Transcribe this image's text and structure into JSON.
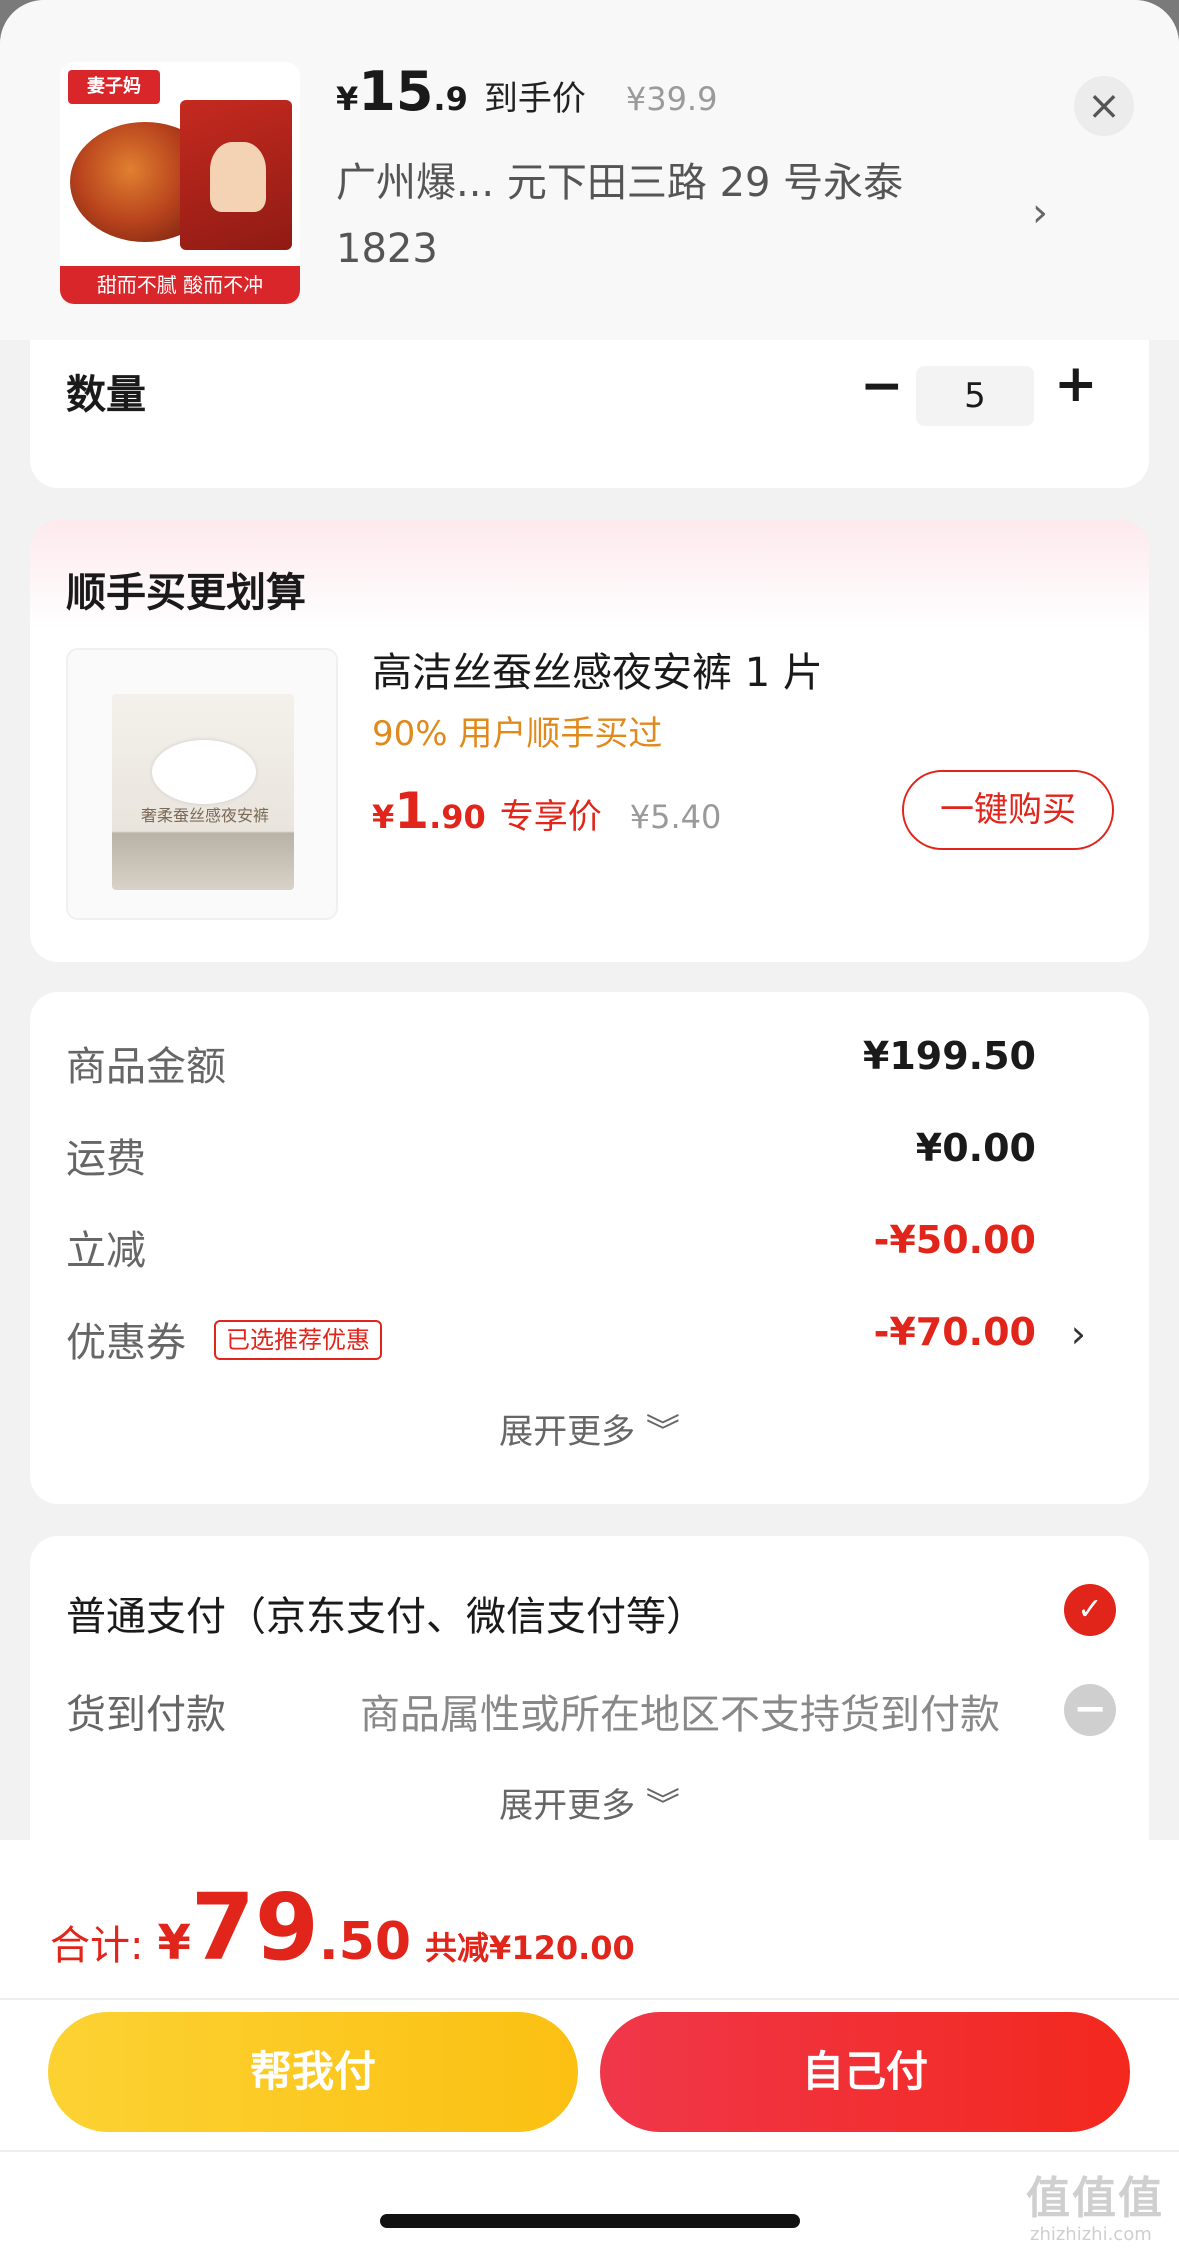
{
  "product": {
    "thumb_brand": "妻子妈 Maizi Mom",
    "thumb_slogan": "甜而不腻 酸而不冲",
    "price_currency": "¥",
    "price_int": "15",
    "price_dec": ".9",
    "price_tag": "到手价",
    "original_price": "¥39.9",
    "address": "广州爆...  元下田三路 29 号永泰 1823"
  },
  "quantity": {
    "label": "数量",
    "minus": "−",
    "value": "5",
    "plus": "+"
  },
  "upsell": {
    "title": "顺手买更划算",
    "item_image_text": "奢柔蚕丝感夜安裤",
    "item_name": "高洁丝蚕丝感夜安裤 1 片",
    "popularity": "90% 用户顺手买过",
    "price_currency": "¥",
    "price_int": "1",
    "price_dec": ".90",
    "price_tag": "专享价",
    "original_price": "¥5.40",
    "buy_button": "一键购买"
  },
  "summary": {
    "rows": [
      {
        "label": "商品金额",
        "value": "¥199.50"
      },
      {
        "label": "运费",
        "value": "¥0.00"
      },
      {
        "label": "立减",
        "value": "-¥50.00"
      },
      {
        "label": "优惠券",
        "value": "-¥70.00",
        "badge": "已选推荐优惠"
      }
    ],
    "expand_label": "展开更多 ︾"
  },
  "payment": {
    "option_normal": "普通支付（京东支付、微信支付等）",
    "option_cod": "货到付款",
    "cod_note": "商品属性或所在地区不支持货到付款",
    "expand_label": "展开更多 ︾"
  },
  "footer": {
    "total_label": "合计:",
    "total_currency": "¥",
    "total_int": "79",
    "total_dec": ".50",
    "total_saved": "共减¥120.00",
    "btn_help": "帮我付",
    "btn_self": "自己付"
  },
  "watermark": {
    "text": "值值值",
    "sub": "zhizhizhi.com"
  },
  "colors": {
    "accent_red": "#e1251b",
    "help_yellow": "#fbc012",
    "popularity_orange": "#e08a1e"
  }
}
